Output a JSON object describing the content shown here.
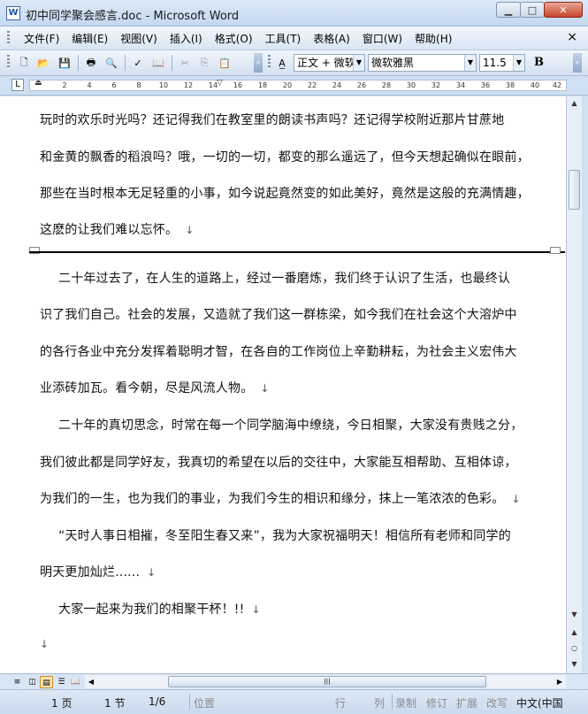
{
  "window": {
    "title": "初中同学聚会感言.doc - Microsoft Word",
    "app_icon": "W"
  },
  "menu": {
    "items": [
      "文件(F)",
      "编辑(E)",
      "视图(V)",
      "插入(I)",
      "格式(O)",
      "工具(T)",
      "表格(A)",
      "窗口(W)",
      "帮助(H)"
    ],
    "close_glyph": "×"
  },
  "toolbar": {
    "style_value": "正文 + 微软",
    "font_value": "微软雅黑",
    "size_value": "11.5",
    "bold_label": "B"
  },
  "ruler": {
    "ticks": [
      "2",
      "4",
      "6",
      "8",
      "10",
      "12",
      "14",
      "16",
      "18",
      "20",
      "22",
      "24",
      "26",
      "28",
      "30",
      "32",
      "34",
      "36",
      "38",
      "40",
      "42"
    ]
  },
  "document": {
    "lines": [
      "玩时的欢乐时光吗？还记得我们在教室里的朗读书声吗？还记得学校附近那片甘蔗地",
      "和金黄的飘香的稻浪吗？哦，一切的一切，都变的那么遥远了，但今天想起确似在眼前，",
      "那些在当时根本无足轻重的小事，如今说起竟然变的如此美好，竟然是这般的充满情趣，",
      "这麽的让我们难以忘怀。",
      "二十年过去了，在人生的道路上，经过一番磨炼，我们终于认识了生活，也最终认",
      "识了我们自己。社会的发展，又造就了我们这一群栋梁，如今我们在社会这个大溶炉中",
      "的各行各业中充分发挥着聪明才智，在各自的工作岗位上辛勤耕耘，为社会主义宏伟大",
      "业添砖加瓦。看今朝，尽是风流人物。",
      "二十年的真切思念，时常在每一个同学脑海中缭绕，今日相聚，大家没有贵贱之分，",
      "我们彼此都是同学好友，我真切的希望在以后的交往中，大家能互相帮助、互相体谅，",
      "为我们的一生，也为我们的事业，为我们今生的相识和缘分，抹上一笔浓浓的色彩。",
      "“天时人事日相摧，冬至阳生春又来”，我为大家祝福明天！相信所有老师和同学的",
      "明天更加灿烂......",
      "大家一起来为我们的相聚干杯！!!"
    ],
    "paragraph_mark": "↓"
  },
  "status": {
    "page": "1 页",
    "section": "1 节",
    "page_of": "1/6",
    "position": "位置",
    "line": "行",
    "column": "列",
    "rec": "录制",
    "trk": "修订",
    "ext": "扩展",
    "ovr": "改写",
    "language": "中文(中国"
  }
}
